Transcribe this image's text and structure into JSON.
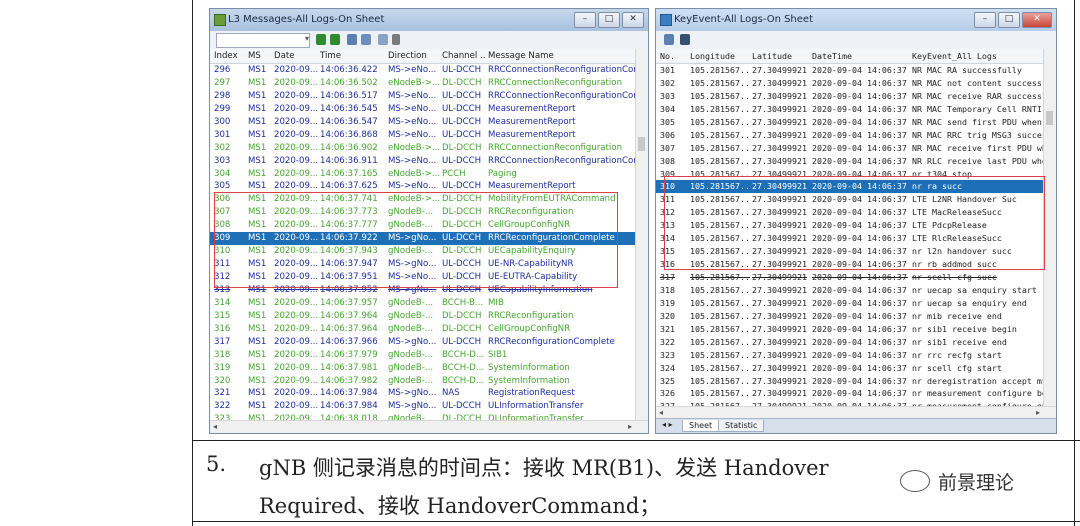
{
  "l3_window": {
    "title": "L3 Messages-All Logs-On Sheet",
    "columns": [
      "Index",
      "MS",
      "Date",
      "Time",
      "Direction",
      "Channel ...",
      "Message Name"
    ],
    "rows": [
      {
        "c": "b",
        "v": [
          "296",
          "MS1",
          "2020-09...",
          "14:06:36.422",
          "MS->eNo...",
          "UL-DCCH",
          "RRCConnectionReconfigurationComp"
        ]
      },
      {
        "c": "g",
        "v": [
          "297",
          "MS1",
          "2020-09...",
          "14:06:36.502",
          "eNodeB->...",
          "DL-DCCH",
          "RRCConnectionReconfiguration"
        ]
      },
      {
        "c": "b",
        "v": [
          "298",
          "MS1",
          "2020-09...",
          "14:06:36.517",
          "MS->eNo...",
          "UL-DCCH",
          "RRCConnectionReconfigurationComp"
        ]
      },
      {
        "c": "b",
        "v": [
          "299",
          "MS1",
          "2020-09...",
          "14:06:36.545",
          "MS->eNo...",
          "UL-DCCH",
          "MeasurementReport"
        ]
      },
      {
        "c": "b",
        "v": [
          "300",
          "MS1",
          "2020-09...",
          "14:06:36.547",
          "MS->eNo...",
          "UL-DCCH",
          "MeasurementReport"
        ]
      },
      {
        "c": "b",
        "v": [
          "301",
          "MS1",
          "2020-09...",
          "14:06:36.868",
          "MS->eNo...",
          "UL-DCCH",
          "MeasurementReport"
        ]
      },
      {
        "c": "g",
        "v": [
          "302",
          "MS1",
          "2020-09...",
          "14:06:36.902",
          "eNodeB->...",
          "DL-DCCH",
          "RRCConnectionReconfiguration"
        ]
      },
      {
        "c": "b",
        "v": [
          "303",
          "MS1",
          "2020-09...",
          "14:06:36.911",
          "MS->eNo...",
          "UL-DCCH",
          "RRCConnectionReconfigurationComp"
        ]
      },
      {
        "c": "g",
        "v": [
          "304",
          "MS1",
          "2020-09...",
          "14:06:37.165",
          "eNodeB->...",
          "PCCH",
          "Paging"
        ]
      },
      {
        "c": "b",
        "v": [
          "305",
          "MS1",
          "2020-09...",
          "14:06:37.625",
          "MS->eNo...",
          "UL-DCCH",
          "MeasurementReport"
        ]
      },
      {
        "c": "g",
        "v": [
          "306",
          "MS1",
          "2020-09...",
          "14:06:37.741",
          "eNodeB->...",
          "DL-DCCH",
          "MobilityFromEUTRACommand"
        ]
      },
      {
        "c": "g",
        "v": [
          "307",
          "MS1",
          "2020-09...",
          "14:06:37.773",
          "gNodeB-...",
          "DL-DCCH",
          "RRCReconfiguration"
        ]
      },
      {
        "c": "g",
        "v": [
          "308",
          "MS1",
          "2020-09...",
          "14:06:37.777",
          "gNodeB-...",
          "DL-DCCH",
          "CellGroupConfigNR"
        ]
      },
      {
        "c": "sel",
        "v": [
          "309",
          "MS1",
          "2020-09...",
          "14:06:37.922",
          "MS->gNo...",
          "UL-DCCH",
          "RRCReconfigurationComplete"
        ]
      },
      {
        "c": "g",
        "v": [
          "310",
          "MS1",
          "2020-09...",
          "14:06:37.943",
          "gNodeB-...",
          "DL-DCCH",
          "UECapabilityEnquiry"
        ]
      },
      {
        "c": "b",
        "v": [
          "311",
          "MS1",
          "2020-09...",
          "14:06:37.947",
          "MS->gNo...",
          "UL-DCCH",
          "UE-NR-CapabilityNR"
        ]
      },
      {
        "c": "b",
        "v": [
          "312",
          "MS1",
          "2020-09...",
          "14:06:37.951",
          "MS->eNo...",
          "UL-DCCH",
          "UE-EUTRA-Capability"
        ]
      },
      {
        "c": "b strike",
        "v": [
          "313",
          "MS1",
          "2020-09...",
          "14:06:37.952",
          "MS->gNo...",
          "UL-DCCH",
          "UECapabilityInformation"
        ]
      },
      {
        "c": "g",
        "v": [
          "314",
          "MS1",
          "2020-09...",
          "14:06:37.957",
          "gNodeB-...",
          "BCCH-B...",
          "MIB"
        ]
      },
      {
        "c": "g",
        "v": [
          "315",
          "MS1",
          "2020-09...",
          "14:06:37.964",
          "gNodeB-...",
          "DL-DCCH",
          "RRCReconfiguration"
        ]
      },
      {
        "c": "g",
        "v": [
          "316",
          "MS1",
          "2020-09...",
          "14:06:37.964",
          "gNodeB-...",
          "DL-DCCH",
          "CellGroupConfigNR"
        ]
      },
      {
        "c": "b",
        "v": [
          "317",
          "MS1",
          "2020-09...",
          "14:06:37.966",
          "MS->gNo...",
          "UL-DCCH",
          "RRCReconfigurationComplete"
        ]
      },
      {
        "c": "g",
        "v": [
          "318",
          "MS1",
          "2020-09...",
          "14:06:37.979",
          "gNodeB-...",
          "BCCH-D...",
          "SIB1"
        ]
      },
      {
        "c": "g",
        "v": [
          "319",
          "MS1",
          "2020-09...",
          "14:06:37.981",
          "gNodeB-...",
          "BCCH-D...",
          "SystemInformation"
        ]
      },
      {
        "c": "g",
        "v": [
          "320",
          "MS1",
          "2020-09...",
          "14:06:37.982",
          "gNodeB-...",
          "BCCH-D...",
          "SystemInformation"
        ]
      },
      {
        "c": "b",
        "v": [
          "321",
          "MS1",
          "2020-09...",
          "14:06:37.984",
          "MS->gNo...",
          "NAS",
          "RegistrationRequest"
        ]
      },
      {
        "c": "b",
        "v": [
          "322",
          "MS1",
          "2020-09...",
          "14:06:37.984",
          "MS->gNo...",
          "UL-DCCH",
          "ULInformationTransfer"
        ]
      },
      {
        "c": "g",
        "v": [
          "323",
          "MS1",
          "2020-09...",
          "14:06:38.018",
          "gNodeB-...",
          "DL-DCCH",
          "DLInformationTransfer"
        ]
      }
    ]
  },
  "kv_window": {
    "title": "KeyEvent-All Logs-On Sheet",
    "columns": [
      "No.",
      "Longitude",
      "Latitude",
      "DateTime",
      "KeyEvent_All Logs"
    ],
    "rows": [
      {
        "c": "bk",
        "v": [
          "301",
          "105.281567...",
          "27.30499921",
          "2020-09-04 14:06:37...",
          "NR MAC RA successfully"
        ]
      },
      {
        "c": "bk",
        "v": [
          "302",
          "105.281567...",
          "27.30499921",
          "2020-09-04 14:06:37...",
          "NR MAC not content successfully"
        ]
      },
      {
        "c": "bk",
        "v": [
          "303",
          "105.281567...",
          "27.30499921",
          "2020-09-04 14:06:37...",
          "NR MAC receive RAR successfully"
        ]
      },
      {
        "c": "bk",
        "v": [
          "304",
          "105.281567...",
          "27.30499921",
          "2020-09-04 14:06:37...",
          "NR MAC Temporary Cell RNTI"
        ]
      },
      {
        "c": "bk",
        "v": [
          "305",
          "105.281567...",
          "27.30499921",
          "2020-09-04 14:06:37...",
          "NR MAC send first PDU when SCell"
        ]
      },
      {
        "c": "bk",
        "v": [
          "306",
          "105.281567...",
          "27.30499921",
          "2020-09-04 14:06:37...",
          "NR MAC RRC trig MSG3 successfully"
        ]
      },
      {
        "c": "bk",
        "v": [
          "307",
          "105.281567...",
          "27.30499921",
          "2020-09-04 14:06:37...",
          "NR MAC receive first PDU when SC"
        ]
      },
      {
        "c": "bk",
        "v": [
          "308",
          "105.281567...",
          "27.30499921",
          "2020-09-04 14:06:37...",
          "NR RLC receive last PDU when SC"
        ]
      },
      {
        "c": "bk",
        "v": [
          "309",
          "105.281567...",
          "27.30499921",
          "2020-09-04 14:06:37...",
          "nr t304 stop"
        ]
      },
      {
        "c": "sel",
        "v": [
          "310",
          "105.281567...",
          "27.30499921",
          "2020-09-04 14:06:37...",
          "nr ra succ"
        ]
      },
      {
        "c": "bk",
        "v": [
          "311",
          "105.281567...",
          "27.30499921",
          "2020-09-04 14:06:37...",
          "LTE L2NR Handover Suc"
        ]
      },
      {
        "c": "bk",
        "v": [
          "312",
          "105.281567...",
          "27.30499921",
          "2020-09-04 14:06:37...",
          "LTE MacReleaseSucc"
        ]
      },
      {
        "c": "bk",
        "v": [
          "313",
          "105.281567...",
          "27.30499921",
          "2020-09-04 14:06:37...",
          "LTE PdcpRelease"
        ]
      },
      {
        "c": "bk",
        "v": [
          "314",
          "105.281567...",
          "27.30499921",
          "2020-09-04 14:06:37...",
          "LTE RlcReleaseSucc"
        ]
      },
      {
        "c": "bk",
        "v": [
          "315",
          "105.281567...",
          "27.30499921",
          "2020-09-04 14:06:37...",
          "nr l2n handover succ"
        ]
      },
      {
        "c": "bk",
        "v": [
          "316",
          "105.281567...",
          "27.30499921",
          "2020-09-04 14:06:37...",
          "nr rb addmod succ"
        ]
      },
      {
        "c": "bk strike",
        "v": [
          "317",
          "105.281567...",
          "27.30499921",
          "2020-09-04 14:06:37...",
          "nr scell cfg succ"
        ]
      },
      {
        "c": "bk",
        "v": [
          "318",
          "105.281567...",
          "27.30499921",
          "2020-09-04 14:06:37...",
          "nr uecap sa enquiry start"
        ]
      },
      {
        "c": "bk",
        "v": [
          "319",
          "105.281567...",
          "27.30499921",
          "2020-09-04 14:06:37...",
          "nr uecap sa enquiry end"
        ]
      },
      {
        "c": "bk",
        "v": [
          "320",
          "105.281567...",
          "27.30499921",
          "2020-09-04 14:06:37...",
          "nr mib receive end"
        ]
      },
      {
        "c": "bk",
        "v": [
          "321",
          "105.281567...",
          "27.30499921",
          "2020-09-04 14:06:37...",
          "nr sib1 receive begin"
        ]
      },
      {
        "c": "bk",
        "v": [
          "322",
          "105.281567...",
          "27.30499921",
          "2020-09-04 14:06:37...",
          "nr sib1 receive end"
        ]
      },
      {
        "c": "bk",
        "v": [
          "323",
          "105.281567...",
          "27.30499921",
          "2020-09-04 14:06:37...",
          "nr rrc recfg start"
        ]
      },
      {
        "c": "bk",
        "v": [
          "324",
          "105.281567...",
          "27.30499921",
          "2020-09-04 14:06:37...",
          "nr scell cfg start"
        ]
      },
      {
        "c": "bk",
        "v": [
          "325",
          "105.281567...",
          "27.30499921",
          "2020-09-04 14:06:37...",
          "nr deregistration accept mt"
        ]
      },
      {
        "c": "bk",
        "v": [
          "326",
          "105.281567...",
          "27.30499921",
          "2020-09-04 14:06:37...",
          "nr measurement configure begin"
        ]
      },
      {
        "c": "bk",
        "v": [
          "327",
          "105.281567...",
          "27.30499921",
          "2020-09-04 14:06:37...",
          "nr measurement configure end"
        ]
      }
    ],
    "sheet_tabs": [
      "Sheet",
      "Statistic"
    ]
  },
  "caption": {
    "number": "5.",
    "line1": "gNB 侧记录消息的时间点：接收 MR(B1)、发送 Handover",
    "line2": "Required、接收 HandoverCommand；"
  },
  "watermark": "前景理论"
}
